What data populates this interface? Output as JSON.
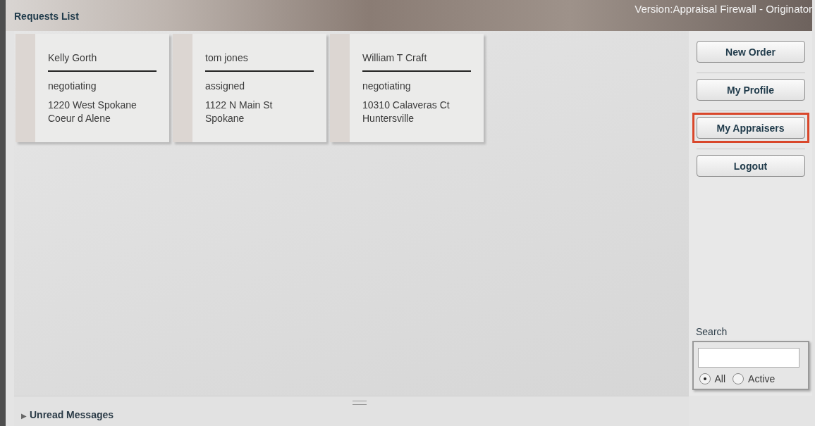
{
  "header": {
    "title": "Requests List",
    "version": "Version:Appraisal Firewall - Originator"
  },
  "requests": [
    {
      "name": "Kelly Gorth",
      "status": "negotiating",
      "address": "1220 West Spokane",
      "city": "Coeur d Alene"
    },
    {
      "name": "tom jones",
      "status": "assigned",
      "address": "1122 N Main St",
      "city": "Spokane"
    },
    {
      "name": "William T Craft",
      "status": "negotiating",
      "address": "10310 Calaveras Ct",
      "city": "Huntersville"
    }
  ],
  "sidebar": {
    "buttons": [
      {
        "label": "New Order",
        "highlighted": false
      },
      {
        "label": "My Profile",
        "highlighted": false
      },
      {
        "label": "My Appraisers",
        "highlighted": true
      },
      {
        "label": "Logout",
        "highlighted": false
      }
    ],
    "search": {
      "label": "Search",
      "filters": [
        {
          "label": "All",
          "selected": true
        },
        {
          "label": "Active",
          "selected": false
        }
      ]
    }
  },
  "footer": {
    "toggle": "▶",
    "label": "Unread Messages"
  }
}
